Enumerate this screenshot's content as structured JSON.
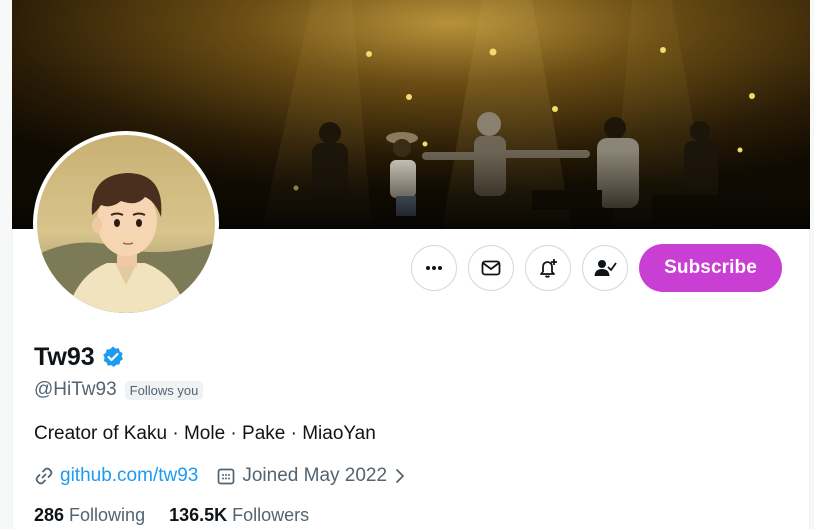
{
  "profile": {
    "display_name": "Tw93",
    "handle": "@HiTw93",
    "follows_you": "Follows you",
    "bio": "Creator of Kaku · Mole · Pake · MiaoYan",
    "website": "github.com/tw93",
    "joined": "Joined May 2022",
    "verified": true
  },
  "actions": {
    "more": "more-icon",
    "message": "message-icon",
    "notify": "bell-plus-icon",
    "following": "person-check-icon",
    "subscribe_label": "Subscribe"
  },
  "stats": {
    "following_count": "286",
    "following_label": "Following",
    "followers_count": "136.5K",
    "followers_label": "Followers"
  },
  "colors": {
    "subscribe": "#c93fd4",
    "link": "#1d9bf0",
    "verified": "#1d9bf0",
    "secondary_text": "#536471"
  }
}
